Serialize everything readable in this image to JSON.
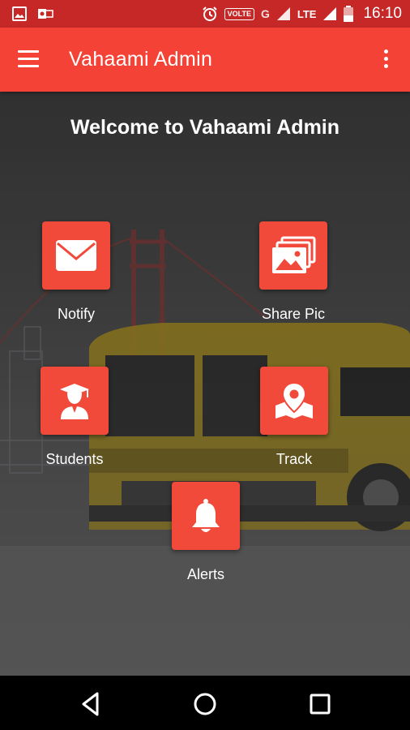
{
  "status_bar": {
    "volte": "VOLTE",
    "network_g": "G",
    "lte": "LTE",
    "time": "16:10"
  },
  "app_bar": {
    "title": "Vahaami Admin"
  },
  "main": {
    "welcome": "Welcome to Vahaami Admin",
    "tiles": [
      {
        "label": "Notify",
        "icon": "envelope-icon"
      },
      {
        "label": "Share Pic",
        "icon": "gallery-icon"
      },
      {
        "label": "Students",
        "icon": "graduate-icon"
      },
      {
        "label": "Track",
        "icon": "map-pin-icon"
      },
      {
        "label": "Alerts",
        "icon": "bell-icon"
      }
    ]
  },
  "colors": {
    "status_bar": "#c62828",
    "app_bar": "#f44336",
    "tile": "#f1493a"
  }
}
